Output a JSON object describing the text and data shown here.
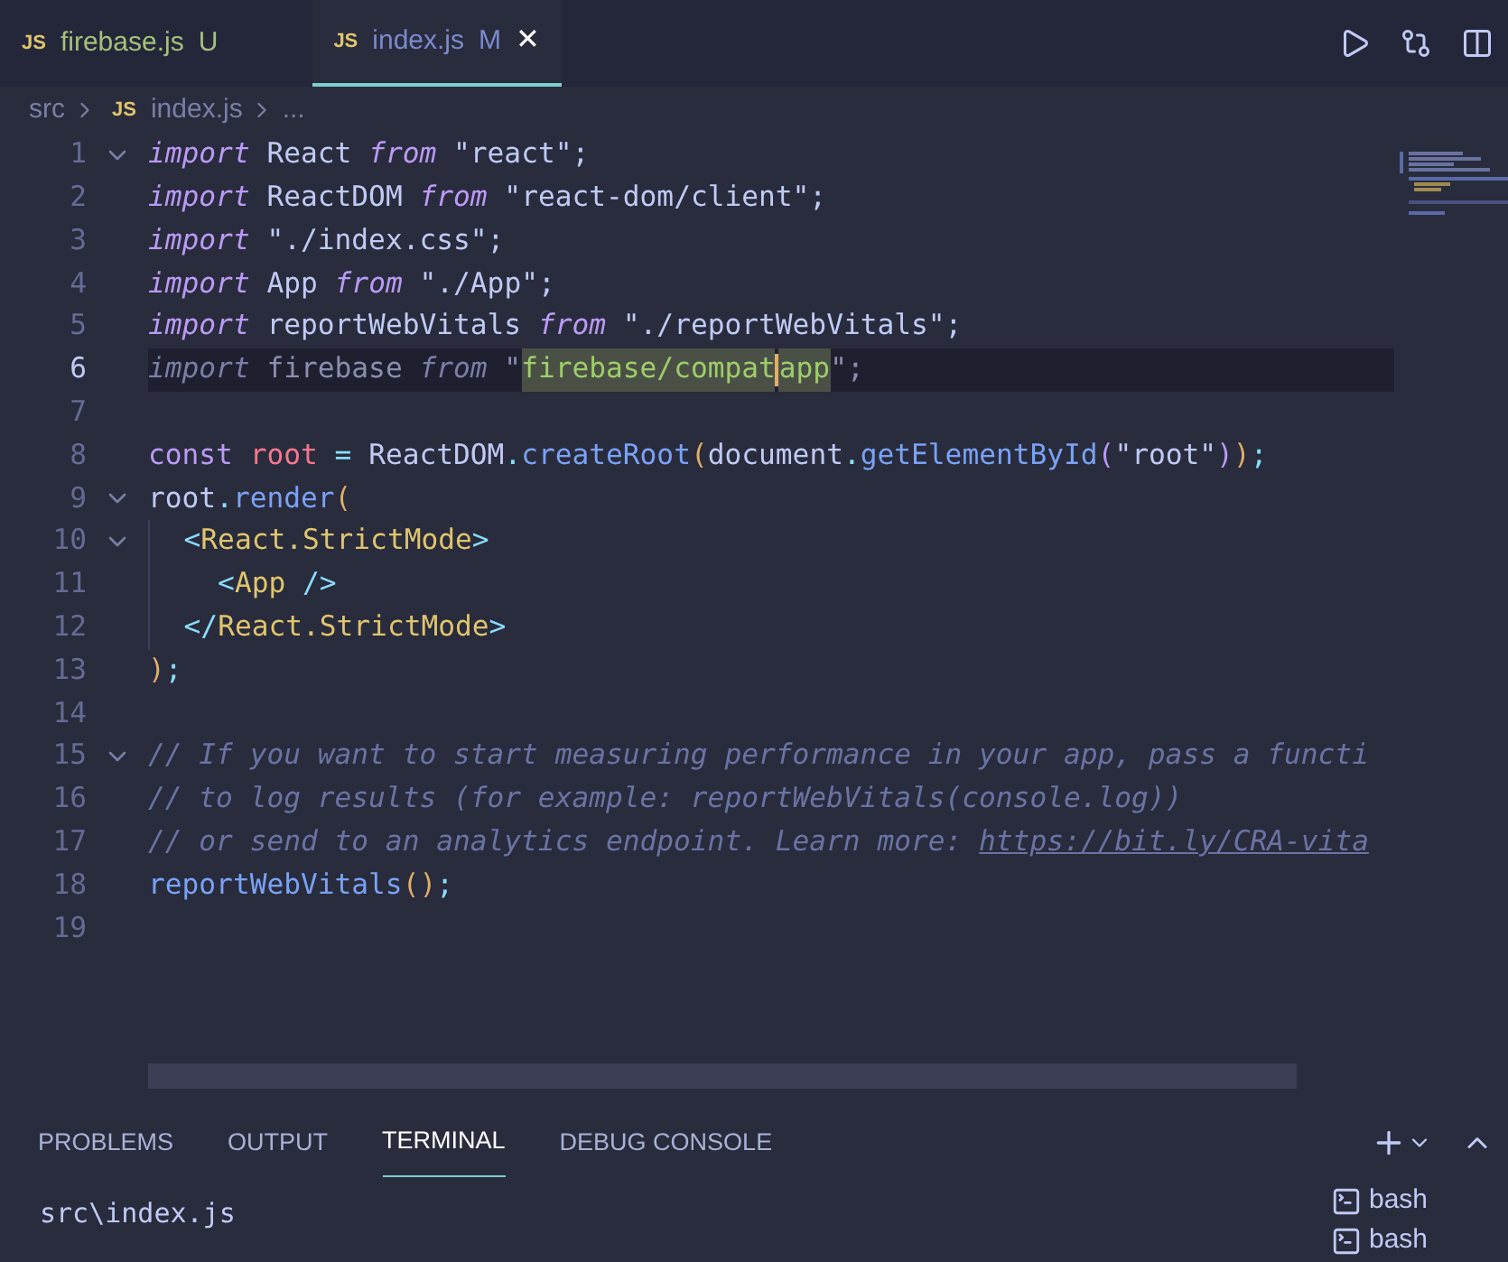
{
  "tabs": [
    {
      "badge": "JS",
      "label": "firebase.js",
      "status": "U",
      "selected": false
    },
    {
      "badge": "JS",
      "label": "index.js",
      "status": "M",
      "selected": true,
      "close": "✕"
    }
  ],
  "breadcrumb": {
    "folder": "src",
    "badge": "JS",
    "file": "index.js",
    "more": "..."
  },
  "editor": {
    "lines": [
      {
        "number": "1",
        "fold": true,
        "active": false,
        "guide": false,
        "tokens": [
          {
            "text": "import",
            "kind": "keyword"
          },
          {
            "text": " React ",
            "kind": "name"
          },
          {
            "text": "from",
            "kind": "keyword"
          },
          {
            "text": " \"react\";",
            "kind": "string"
          }
        ]
      },
      {
        "number": "2",
        "fold": false,
        "active": false,
        "guide": false,
        "tokens": [
          {
            "text": "import",
            "kind": "keyword"
          },
          {
            "text": " ReactDOM ",
            "kind": "name"
          },
          {
            "text": "from",
            "kind": "keyword"
          },
          {
            "text": " \"react-dom/client\";",
            "kind": "string"
          }
        ]
      },
      {
        "number": "3",
        "fold": false,
        "active": false,
        "guide": false,
        "tokens": [
          {
            "text": "import",
            "kind": "keyword"
          },
          {
            "text": " \"./index.css\";",
            "kind": "string"
          }
        ]
      },
      {
        "number": "4",
        "fold": false,
        "active": false,
        "guide": false,
        "tokens": [
          {
            "text": "import",
            "kind": "keyword"
          },
          {
            "text": " App ",
            "kind": "name"
          },
          {
            "text": "from",
            "kind": "keyword"
          },
          {
            "text": " \"./App\";",
            "kind": "string"
          }
        ]
      },
      {
        "number": "5",
        "fold": false,
        "active": false,
        "guide": false,
        "tokens": [
          {
            "text": "import",
            "kind": "keyword"
          },
          {
            "text": " reportWebVitals ",
            "kind": "name"
          },
          {
            "text": "from",
            "kind": "keyword"
          },
          {
            "text": " \"./reportWebVitals\";",
            "kind": "string"
          }
        ]
      },
      {
        "number": "6",
        "fold": false,
        "active": true,
        "guide": false,
        "tokens": [
          {
            "text": "import",
            "kind": "dim-keyword"
          },
          {
            "text": " firebase ",
            "kind": "dim"
          },
          {
            "text": "from",
            "kind": "dim-keyword"
          },
          {
            "text": " \"",
            "kind": "dim"
          },
          {
            "text": "firebase/compat",
            "kind": "selection"
          },
          {
            "kind": "cursor"
          },
          {
            "text": "app",
            "kind": "selection"
          },
          {
            "text": "\";",
            "kind": "dim"
          }
        ]
      },
      {
        "number": "7",
        "fold": false,
        "active": false,
        "guide": false
      },
      {
        "number": "8",
        "fold": false,
        "active": false,
        "guide": false,
        "tokens": [
          {
            "text": "const",
            "kind": "storage"
          },
          {
            "text": " root",
            "kind": "variable"
          },
          {
            "text": " = ",
            "kind": "operator"
          },
          {
            "text": "ReactDOM",
            "kind": "name"
          },
          {
            "text": ".",
            "kind": "operator"
          },
          {
            "text": "createRoot",
            "kind": "function"
          },
          {
            "text": "(",
            "kind": "paren"
          },
          {
            "text": "document",
            "kind": "name"
          },
          {
            "text": ".",
            "kind": "operator"
          },
          {
            "text": "getElementById",
            "kind": "function"
          },
          {
            "text": "(",
            "kind": "paren2"
          },
          {
            "text": "\"root\"",
            "kind": "string"
          },
          {
            "text": ")",
            "kind": "paren2"
          },
          {
            "text": ")",
            "kind": "paren"
          },
          {
            "text": ";",
            "kind": "operator"
          }
        ]
      },
      {
        "number": "9",
        "fold": true,
        "active": false,
        "guide": false,
        "tokens": [
          {
            "text": "root",
            "kind": "name"
          },
          {
            "text": ".",
            "kind": "operator"
          },
          {
            "text": "render",
            "kind": "function"
          },
          {
            "text": "(",
            "kind": "paren"
          }
        ]
      },
      {
        "number": "10",
        "fold": true,
        "active": false,
        "guide": true,
        "tokens": [
          {
            "text": "  <",
            "kind": "operator"
          },
          {
            "text": "React.StrictMode",
            "kind": "tag"
          },
          {
            "text": ">",
            "kind": "operator"
          }
        ]
      },
      {
        "number": "11",
        "fold": false,
        "active": false,
        "guide": true,
        "tokens": [
          {
            "text": "    <",
            "kind": "operator"
          },
          {
            "text": "App",
            "kind": "tag"
          },
          {
            "text": " />",
            "kind": "operator"
          }
        ]
      },
      {
        "number": "12",
        "fold": false,
        "active": false,
        "guide": true,
        "tokens": [
          {
            "text": "  </",
            "kind": "operator"
          },
          {
            "text": "React.StrictMode",
            "kind": "tag"
          },
          {
            "text": ">",
            "kind": "operator"
          }
        ]
      },
      {
        "number": "13",
        "fold": false,
        "active": false,
        "guide": false,
        "tokens": [
          {
            "text": ")",
            "kind": "paren"
          },
          {
            "text": ";",
            "kind": "operator"
          }
        ]
      },
      {
        "number": "14",
        "fold": false,
        "active": false,
        "guide": false
      },
      {
        "number": "15",
        "fold": true,
        "active": false,
        "guide": false,
        "tokens": [
          {
            "text": "// If you want to start measuring performance in your app, pass a functi",
            "kind": "comment"
          }
        ]
      },
      {
        "number": "16",
        "fold": false,
        "active": false,
        "guide": false,
        "tokens": [
          {
            "text": "// to log results (for example: reportWebVitals(console.log))",
            "kind": "comment"
          }
        ]
      },
      {
        "number": "17",
        "fold": false,
        "active": false,
        "guide": false,
        "tokens": [
          {
            "text": "// or send to an analytics endpoint. Learn more: ",
            "kind": "comment"
          },
          {
            "text": "https://bit.ly/CRA-vita",
            "kind": "link"
          }
        ]
      },
      {
        "number": "18",
        "fold": false,
        "active": false,
        "guide": false,
        "tokens": [
          {
            "text": "reportWebVitals",
            "kind": "function"
          },
          {
            "text": "()",
            "kind": "paren"
          },
          {
            "text": ";",
            "kind": "operator"
          }
        ]
      },
      {
        "number": "19",
        "fold": false,
        "active": false,
        "guide": false
      }
    ]
  },
  "panel": {
    "tabs": [
      {
        "label": "PROBLEMS",
        "selected": false
      },
      {
        "label": "OUTPUT",
        "selected": false
      },
      {
        "label": "TERMINAL",
        "selected": true
      },
      {
        "label": "DEBUG CONSOLE",
        "selected": false
      }
    ],
    "terminal_lines": [
      "src\\index.js"
    ],
    "terminals": [
      "bash",
      "bash"
    ]
  }
}
